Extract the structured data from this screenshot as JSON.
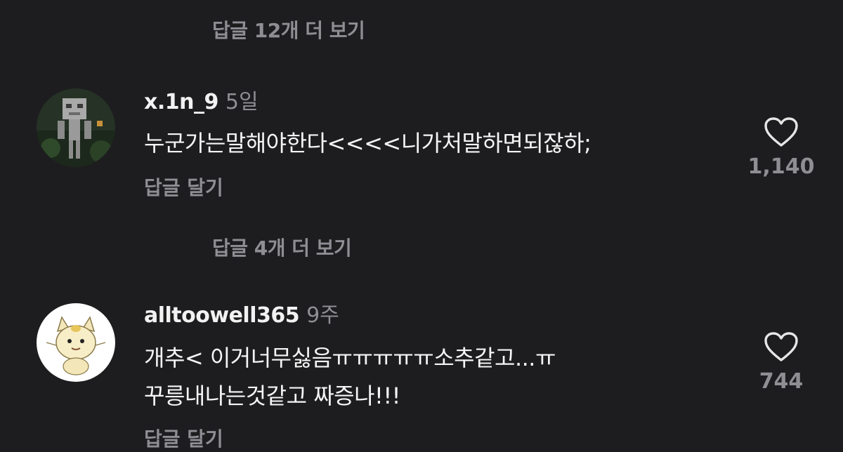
{
  "thread": {
    "view_more_top": "답글 12개 더 보기",
    "view_more_middle": "답글 4개 더 보기"
  },
  "comments": [
    {
      "username": "x.1n_9",
      "time": "5일",
      "text": "누군가는말해야한다<<<<니가처말하면되잖하;",
      "reply_label": "답글 달기",
      "likes": "1,140",
      "like_icon": "heart-outline-icon",
      "avatar": "skeleton-avatar"
    },
    {
      "username": "alltoowell365",
      "time": "9주",
      "text_line1": "개추< 이거너무싫음ㅠㅠㅠㅠㅠ소추같고...ㅠ",
      "text_line2": "꾸릉내나는것같고 짜증나!!!",
      "reply_label": "답글 달기",
      "likes": "744",
      "like_icon": "heart-outline-icon",
      "avatar": "cat-avatar"
    }
  ],
  "colors": {
    "background": "#1d1d1f",
    "primary_text": "#f2f2f2",
    "secondary_text": "#8e8e93"
  }
}
